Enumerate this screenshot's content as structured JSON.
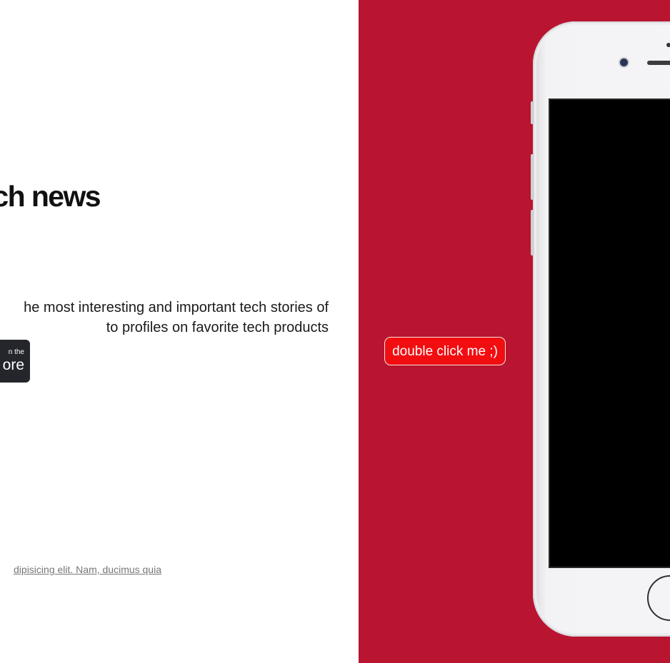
{
  "hero": {
    "headline": "ch news",
    "description_line1": "he most interesting and important tech stories of",
    "description_line2": "to profiles on favorite tech products"
  },
  "store_badge": {
    "small_text": "n the",
    "big_text": "ore"
  },
  "footer": {
    "link_text": "dipisicing elit. Nam, ducimus quia"
  },
  "interaction": {
    "double_click_label": "double click me ;)"
  },
  "colors": {
    "accent_red_panel": "#b91430",
    "button_red": "#f20d10",
    "badge_dark": "#24262b"
  },
  "icons": {
    "phone": "iphone-mockup"
  }
}
